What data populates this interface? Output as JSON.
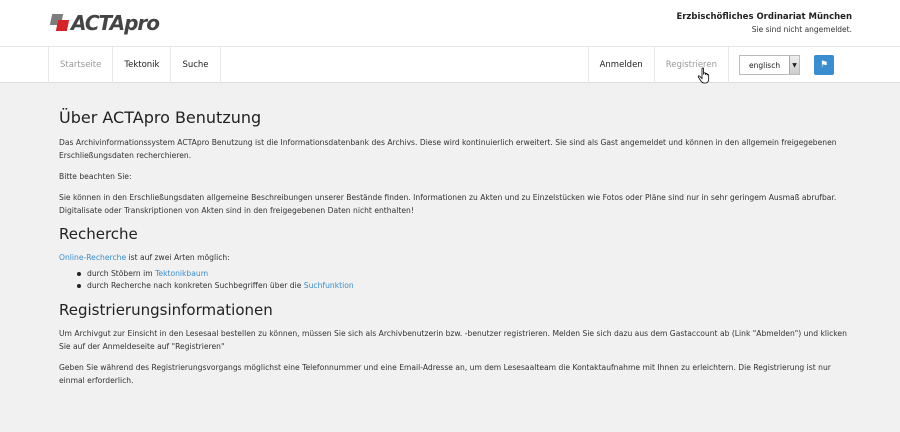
{
  "header": {
    "logo_text": "ACTApro",
    "org_name": "Erzbischöfliches Ordinariat München",
    "login_status": "Sie sind nicht angemeldet."
  },
  "nav": {
    "left": [
      "Startseite",
      "Tektonik",
      "Suche"
    ],
    "login": "Anmelden",
    "register": "Registrieren",
    "language": "englisch"
  },
  "colors": {
    "accent": "#3a8ed0",
    "logo_red": "#d6232a"
  },
  "content": {
    "title": "Über ACTApro Benutzung",
    "intro": "Das Archivinformationssystem ACTApro Benutzung ist die Informationsdatenbank des Archivs. Diese wird kontinuierlich erweitert. Sie sind als Gast angemeldet und können in den allgemein freigegebenen Erschließungsdaten recherchieren.",
    "note_label": "Bitte beachten Sie:",
    "note": "Sie können in den Erschließungsdaten allgemeine Beschreibungen unserer Bestände finden. Informationen zu Akten und zu Einzelstücken wie Fotos oder Pläne sind nur in sehr geringem Ausmaß abrufbar. Digitalisate oder Transkriptionen von Akten sind in den freigegebenen Daten nicht enthalten!",
    "research_title": "Recherche",
    "research_link": "Online-Recherche",
    "research_text": " ist auf zwei Arten möglich:",
    "bullet1_text": "durch Stöbern im ",
    "bullet1_link": "Tektonikbaum",
    "bullet2_text": "durch Recherche nach konkreten Suchbegriffen über die ",
    "bullet2_link": "Suchfunktion",
    "reg_title": "Registrierungsinformationen",
    "reg_p1": "Um Archivgut zur Einsicht in den Lesesaal bestellen zu können, müssen Sie sich als Archivbenutzerin bzw. -benutzer registrieren. Melden Sie sich dazu aus dem Gastaccount ab (Link \"Abmelden\") und klicken Sie auf der Anmeldeseite auf \"Registrieren\"",
    "reg_p2": "Geben Sie während des Registrierungsvorgangs möglichst eine Telefonnummer und eine Email-Adresse an, um dem Lesesaalteam die Kontaktaufnahme mit Ihnen zu erleichtern. Die Registrierung ist nur einmal erforderlich."
  }
}
